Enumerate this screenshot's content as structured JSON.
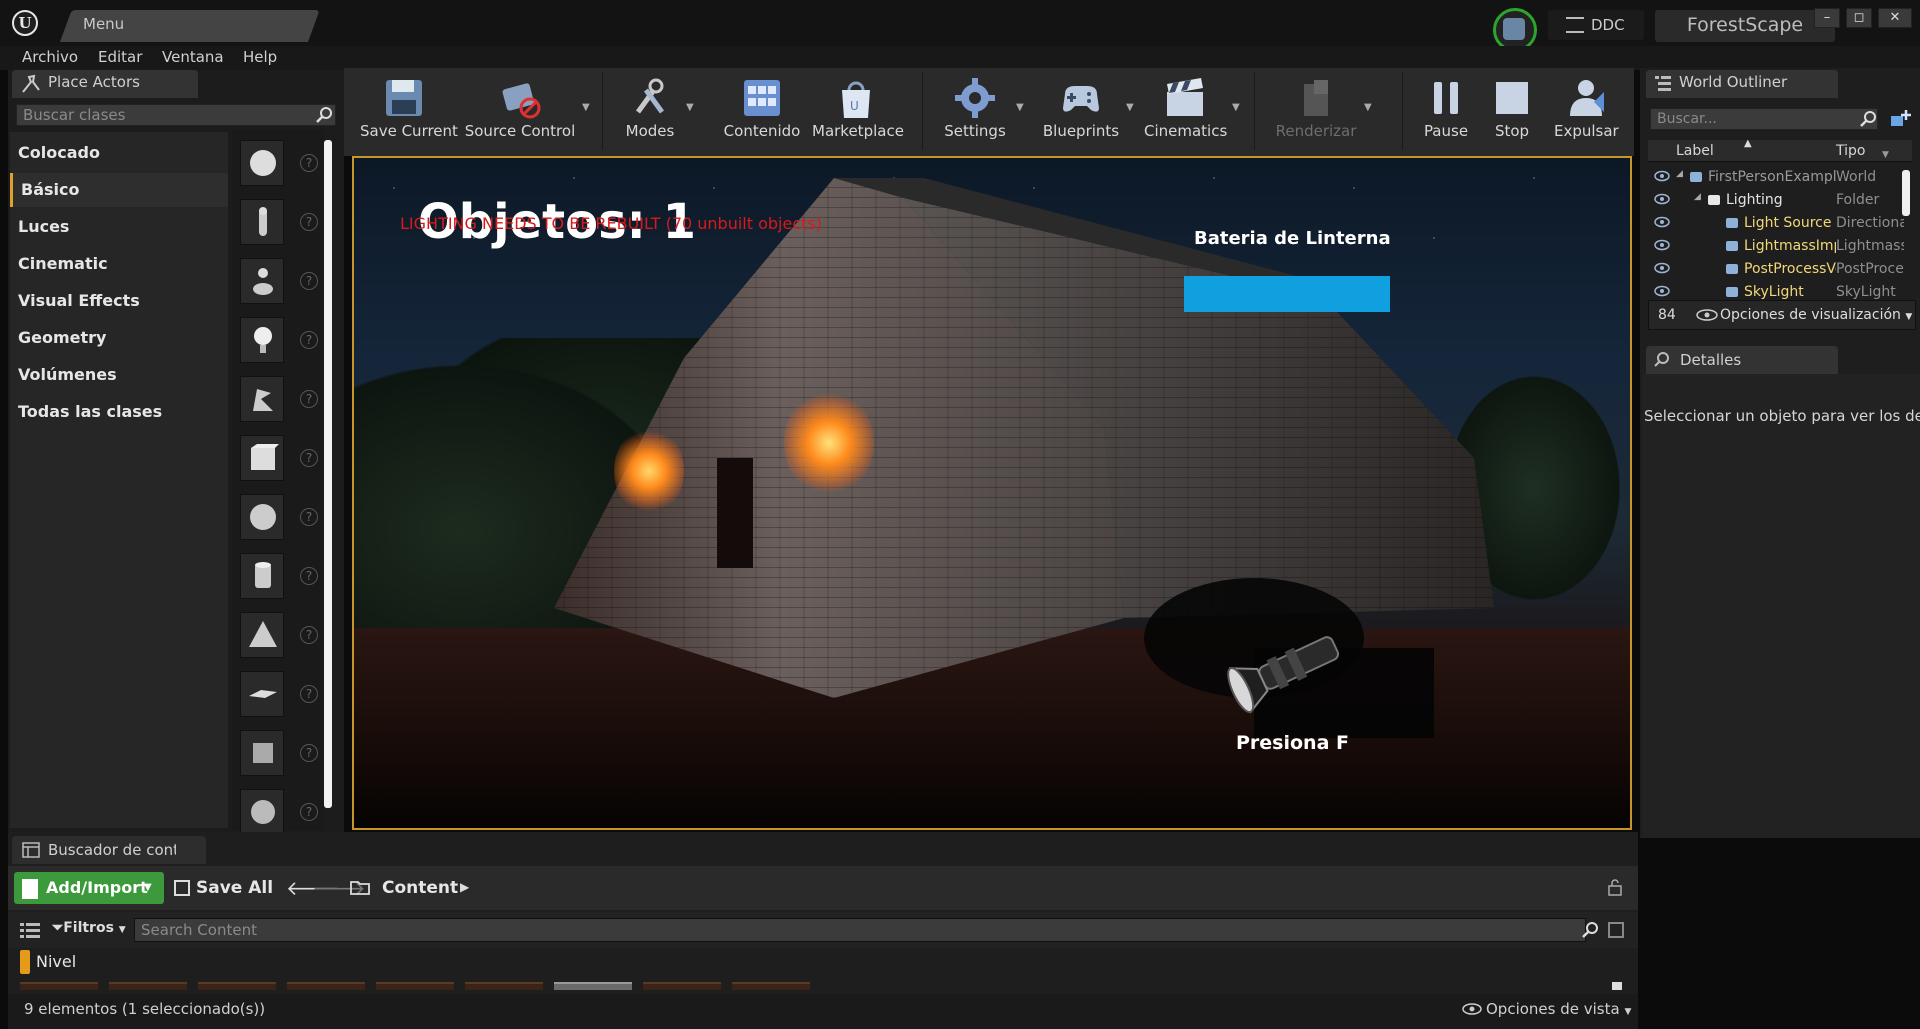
{
  "titlebar": {
    "menu_tab_label": "Menu",
    "ddc_label": "DDC",
    "project_name": "ForestScape",
    "minimize_label": "–",
    "maximize_label": "◻",
    "close_label": "✕"
  },
  "menubar": {
    "items": [
      "Archivo",
      "Editar",
      "Ventana",
      "Help"
    ]
  },
  "place_actors": {
    "tab_label": "Place Actors",
    "search_placeholder": "Buscar clases",
    "categories": [
      {
        "label": "Colocado recientemente",
        "active": false
      },
      {
        "label": "Básico",
        "active": true
      },
      {
        "label": "Luces",
        "active": false
      },
      {
        "label": "Cinematic",
        "active": false
      },
      {
        "label": "Visual Effects",
        "active": false
      },
      {
        "label": "Geometry",
        "active": false
      },
      {
        "label": "Volúmenes",
        "active": false
      },
      {
        "label": "Todas las clases",
        "active": false
      }
    ],
    "actor_icons": [
      "sphere-actor-icon",
      "character-icon",
      "pawn-icon",
      "point-light-icon",
      "player-start-icon",
      "cube-icon",
      "sphere-icon",
      "cylinder-icon",
      "cone-icon",
      "plane-icon",
      "box-trigger-icon",
      "sphere-trigger-icon"
    ],
    "help_glyph": "?"
  },
  "toolbar": {
    "tools": [
      {
        "id": "save-current",
        "label": "Save Current",
        "icon": "floppy-disk-icon",
        "dropdown": false,
        "disabled": false
      },
      {
        "id": "source-control",
        "label": "Source Control",
        "icon": "source-control-icon",
        "dropdown": true,
        "disabled": false
      },
      {
        "id": "modes",
        "label": "Modes",
        "icon": "tools-icon",
        "dropdown": true,
        "disabled": false
      },
      {
        "id": "contenido",
        "label": "Contenido",
        "icon": "content-grid-icon",
        "dropdown": false,
        "disabled": false
      },
      {
        "id": "marketplace",
        "label": "Marketplace",
        "icon": "marketplace-bag-icon",
        "dropdown": false,
        "disabled": false
      },
      {
        "id": "settings",
        "label": "Settings",
        "icon": "settings-gear-icon",
        "dropdown": true,
        "disabled": false
      },
      {
        "id": "blueprints",
        "label": "Blueprints",
        "icon": "gamepad-icon",
        "dropdown": true,
        "disabled": false
      },
      {
        "id": "cinematics",
        "label": "Cinematics",
        "icon": "clapperboard-icon",
        "dropdown": true,
        "disabled": false
      },
      {
        "id": "renderizar",
        "label": "Renderizar",
        "icon": "render-blocks-icon",
        "dropdown": true,
        "disabled": true
      },
      {
        "id": "pause",
        "label": "Pause",
        "icon": "pause-icon",
        "dropdown": false,
        "disabled": false
      },
      {
        "id": "stop",
        "label": "Stop",
        "icon": "stop-icon",
        "dropdown": false,
        "disabled": false
      },
      {
        "id": "expulsar",
        "label": "Expulsar",
        "icon": "eject-player-icon",
        "dropdown": false,
        "disabled": false
      }
    ],
    "dropdown_glyph": "▼"
  },
  "viewport": {
    "hud_objects": "Objetos: 1",
    "lighting_warning": "LIGHTING NEEDS TO BE REBUILT (70 unbuilt objects)",
    "battery_label": "Bateria de Linterna",
    "battery_level": 1.0,
    "press_label": "Presiona F",
    "colors": {
      "battery": "#10a0e0",
      "warning": "#d81a1a",
      "frame": "#c6962a"
    }
  },
  "world_outliner": {
    "tab_label": "World Outliner",
    "search_placeholder": "Buscar...",
    "col_label": "Label",
    "col_type": "Tipo",
    "sort_glyph": "▲",
    "rows": [
      {
        "name": "FirstPersonExampleMap",
        "type": "World",
        "icon": "world-icon",
        "depth": 0,
        "dim": true
      },
      {
        "name": "Lighting",
        "type": "Folder",
        "icon": "folder-icon",
        "depth": 1,
        "dim": false
      },
      {
        "name": "Light Source",
        "type": "DirectionalLight",
        "icon": "directional-light-icon",
        "depth": 2,
        "dim": false,
        "yellow": true
      },
      {
        "name": "LightmassImportanceVolume",
        "type": "LightmassImportanceVolume",
        "icon": "lightmass-volume-icon",
        "depth": 2,
        "dim": false,
        "yellow": true
      },
      {
        "name": "PostProcessVolume",
        "type": "PostProcessVolume",
        "icon": "postprocess-volume-icon",
        "depth": 2,
        "dim": false,
        "yellow": true
      },
      {
        "name": "SkyLight",
        "type": "SkyLight",
        "icon": "skylight-icon",
        "depth": 2,
        "dim": false,
        "yellow": true
      }
    ],
    "actor_count": "84",
    "view_options": "Opciones de visualización"
  },
  "details": {
    "tab_label": "Detalles",
    "hint": "Seleccionar un objeto para ver los detalles"
  },
  "content_browser": {
    "tab_label": "Buscador de contenido",
    "add_import": "Add/Import",
    "save_all": "Save All",
    "nav_back": "🡐",
    "nav_fwd": "🡒",
    "path_root": "Content",
    "path_arrow": "▶",
    "filters": "Filtros",
    "search_placeholder": "Search Content",
    "collection_label": "Nivel",
    "status_count": "9 elementos (1 seleccionado(s))",
    "view_options": "Opciones de vista"
  }
}
